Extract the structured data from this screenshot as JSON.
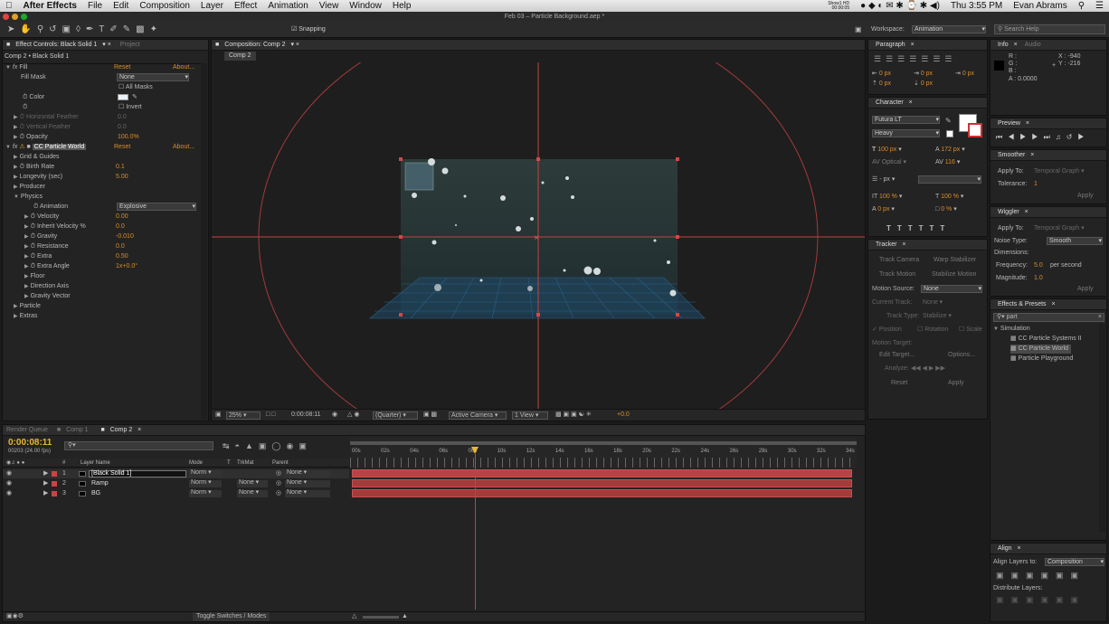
{
  "menubar": {
    "apple": "",
    "app": "After Effects",
    "items": [
      "File",
      "Edit",
      "Composition",
      "Layer",
      "Effect",
      "Animation",
      "View",
      "Window",
      "Help"
    ],
    "status": "Show1 HD",
    "status2": "00:00:05",
    "time": "Thu 3:55 PM",
    "user": "Evan Abrams"
  },
  "titlebar": "Feb 03 – Particle Background.aep *",
  "toolbar": {
    "snapping": "Snapping",
    "workspace_label": "Workspace:",
    "workspace_value": "Animation",
    "search_placeholder": "Search Help"
  },
  "effect_controls": {
    "tab": "Effect Controls: Black Solid 1",
    "tab2": "Project",
    "subtitle": "Comp 2 • Black Solid 1",
    "fill": {
      "name": "Fill",
      "reset": "Reset",
      "about": "About...",
      "fill_mask_label": "Fill Mask",
      "fill_mask_value": "None",
      "all_masks": "All Masks",
      "color_label": "Color",
      "invert": "Invert",
      "hfeather": "Horizontal Feather",
      "hfeather_val": "0.0",
      "vfeather": "Vertical Feather",
      "vfeather_val": "0.0",
      "opacity": "Opacity",
      "opacity_val": "100.0%"
    },
    "ccpw": {
      "name": "CC Particle World",
      "reset": "Reset",
      "about": "About...",
      "grid": "Grid & Guides",
      "birth_rate": "Birth Rate",
      "birth_rate_val": "0.1",
      "longevity": "Longevity (sec)",
      "longevity_val": "5.00",
      "producer": "Producer",
      "physics": "Physics",
      "animation": "Animation",
      "animation_val": "Explosive",
      "velocity": "Velocity",
      "velocity_val": "0.00",
      "inherit": "Inherit Velocity %",
      "inherit_val": "0.0",
      "gravity": "Gravity",
      "gravity_val": "-0.010",
      "resistance": "Resistance",
      "resistance_val": "0.0",
      "extra": "Extra",
      "extra_val": "0.50",
      "extra_angle": "Extra Angle",
      "extra_angle_val": "1x+0.0°",
      "floor": "Floor",
      "direction_axis": "Direction Axis",
      "gravity_vector": "Gravity Vector",
      "particle": "Particle",
      "extras": "Extras"
    }
  },
  "composition": {
    "tab": "Composition: Comp 2",
    "subtab": "Comp 2",
    "zoom": "25%",
    "timecode": "0:00:08:11",
    "quality": "(Quarter)",
    "camera": "Active Camera",
    "views": "1 View",
    "exposure": "+0.0"
  },
  "paragraph": {
    "tab": "Paragraph",
    "vals": [
      "0 px",
      "0 px",
      "0 px",
      "0 px",
      "0 px"
    ]
  },
  "character": {
    "tab": "Character",
    "font": "Futura LT",
    "style": "Heavy",
    "size": "100 px",
    "leading": "172 px",
    "kerning": "Optical",
    "tracking": "116",
    "stroke": "- px",
    "vscale": "100 %",
    "hscale": "100 %",
    "baseline": "0 px",
    "tsume": "0 %"
  },
  "tracker": {
    "tab": "Tracker",
    "track_camera": "Track Camera",
    "warp": "Warp Stabilizer",
    "track_motion": "Track Motion",
    "stabilize": "Stabilize Motion",
    "motion_source": "Motion Source:",
    "motion_source_val": "None",
    "current_track": "Current Track:",
    "current_track_val": "None",
    "track_type": "Track Type:",
    "track_type_val": "Stabilize",
    "position": "Position",
    "rotation": "Rotation",
    "scale": "Scale",
    "motion_target": "Motion Target:",
    "edit_target": "Edit Target...",
    "options": "Options...",
    "analyze": "Analyze:",
    "reset": "Reset",
    "apply": "Apply"
  },
  "info": {
    "tab": "Info",
    "tab2": "Audio",
    "r": "R :",
    "g": "G :",
    "b": "B :",
    "a": "A : 0.0000",
    "x": "X : -940",
    "y": "Y : -216"
  },
  "preview": {
    "tab": "Preview"
  },
  "smoother": {
    "tab": "Smoother",
    "apply_to": "Apply To:",
    "apply_to_val": "Temporal Graph",
    "tolerance": "Tolerance:",
    "tolerance_val": "1",
    "apply": "Apply"
  },
  "wiggler": {
    "tab": "Wiggler",
    "apply_to": "Apply To:",
    "apply_to_val": "Temporal Graph",
    "noise": "Noise Type:",
    "noise_val": "Smooth",
    "dimensions": "Dimensions:",
    "frequency": "Frequency:",
    "frequency_val": "5.0",
    "per_second": "per second",
    "magnitude": "Magnitude:",
    "magnitude_val": "1.0",
    "apply": "Apply"
  },
  "effects_presets": {
    "tab": "Effects & Presets",
    "search_value": "part",
    "category": "Simulation",
    "items": [
      "CC Particle Systems II",
      "CC Particle World",
      "Particle Playground"
    ]
  },
  "align": {
    "tab": "Align",
    "align_to": "Align Layers to:",
    "align_to_val": "Composition",
    "distribute": "Distribute Layers:"
  },
  "timeline": {
    "tabs": [
      "Render Queue",
      "Comp 1",
      "Comp 2"
    ],
    "timecode": "0:00:08:11",
    "frames": "00203 (24.00 fps)",
    "headers": {
      "num": "#",
      "layer": "Layer Name",
      "mode": "Mode",
      "t": "T",
      "trkmat": "TrkMat",
      "parent": "Parent"
    },
    "ruler": [
      "00s",
      "02s",
      "04s",
      "06s",
      "08s",
      "10s",
      "12s",
      "14s",
      "16s",
      "18s",
      "20s",
      "22s",
      "24s",
      "26s",
      "28s",
      "30s",
      "32s",
      "34s"
    ],
    "layers": [
      {
        "num": "1",
        "name": "[Black Solid 1]",
        "mode": "Norm",
        "trkmat": "",
        "parent": "None"
      },
      {
        "num": "2",
        "name": "Ramp",
        "mode": "Norm",
        "trkmat": "None",
        "parent": "None"
      },
      {
        "num": "3",
        "name": "BG",
        "mode": "Norm",
        "trkmat": "None",
        "parent": "None"
      }
    ],
    "toggle": "Toggle Switches / Modes"
  }
}
